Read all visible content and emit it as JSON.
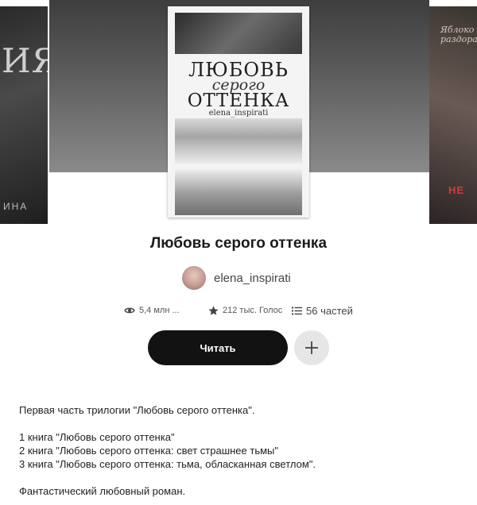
{
  "neighbors": {
    "left_cover_text": "ИЯ",
    "left_cover_bottom": "ИНА",
    "right_cover_text": "Яблоко раздора",
    "right_cover_red": "НЕ"
  },
  "cover": {
    "line1": "ЛЮБОВЬ",
    "line2": "серого",
    "line3": "ОТТЕНКА",
    "author": "elena_inspirati"
  },
  "story": {
    "title": "Любовь серого оттенка",
    "author": "elena_inspirati"
  },
  "stats": {
    "reads": "5,4 млн ...",
    "votes": "212 тыс. Голос",
    "parts": "56 частей"
  },
  "actions": {
    "read_label": "Читать",
    "add_label": "+"
  },
  "description": [
    "Первая часть трилогии \"Любовь серого оттенка\".",
    "",
    "1 книга \"Любовь серого оттенка\"",
    "2 книга \"Любовь серого оттенка: свет страшнее тьмы\"",
    "3 книга \"Любовь серого оттенка: тьма, обласканная светлом\".",
    "",
    "Фантастический любовный роман."
  ],
  "colors": {
    "read_button_bg": "#121212",
    "add_button_bg": "#e6e6e6",
    "accent_red": "#d23a3a"
  }
}
